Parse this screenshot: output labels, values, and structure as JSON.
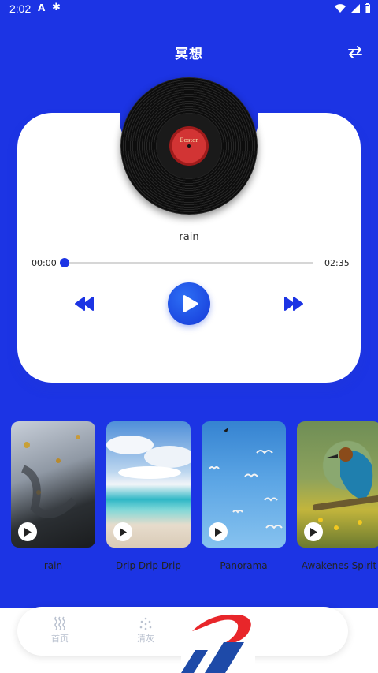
{
  "status_bar": {
    "time": "2:02",
    "icons": [
      "a-icon",
      "bug-icon",
      "wifi-icon",
      "signal-icon",
      "battery-icon"
    ]
  },
  "header": {
    "title": "冥想",
    "switch_icon": "swap-icon"
  },
  "player": {
    "track_name": "rain",
    "record_label": "Bester",
    "current_time": "00:00",
    "total_time": "02:35",
    "progress": 0.0,
    "controls": [
      "previous-icon",
      "play-icon",
      "next-icon"
    ]
  },
  "scenes": [
    {
      "label": "rain",
      "thumb": "rain-window"
    },
    {
      "label": "Drip Drip Drip",
      "thumb": "beach"
    },
    {
      "label": "Panorama",
      "thumb": "sky-birds"
    },
    {
      "label": "Awakenes Spirit",
      "thumb": "bee-eater"
    }
  ],
  "bottom_nav": {
    "items": [
      {
        "label": "首页",
        "icon": "waves-icon"
      },
      {
        "label": "清灰",
        "icon": "dust-icon"
      }
    ]
  },
  "colors": {
    "primary": "#1c34e4",
    "card": "#ffffff",
    "watermark_red": "#e8262a",
    "watermark_blue": "#1e4aa8"
  }
}
